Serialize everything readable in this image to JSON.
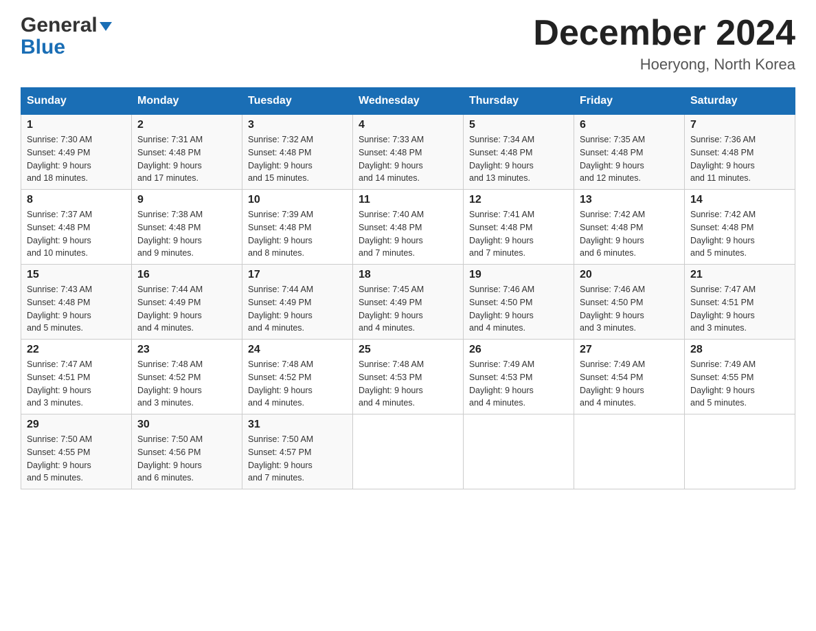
{
  "header": {
    "logo_general": "General",
    "logo_blue": "Blue",
    "month_title": "December 2024",
    "location": "Hoeryong, North Korea"
  },
  "weekdays": [
    "Sunday",
    "Monday",
    "Tuesday",
    "Wednesday",
    "Thursday",
    "Friday",
    "Saturday"
  ],
  "weeks": [
    [
      {
        "day": "1",
        "sunrise": "7:30 AM",
        "sunset": "4:49 PM",
        "daylight": "9 hours and 18 minutes."
      },
      {
        "day": "2",
        "sunrise": "7:31 AM",
        "sunset": "4:48 PM",
        "daylight": "9 hours and 17 minutes."
      },
      {
        "day": "3",
        "sunrise": "7:32 AM",
        "sunset": "4:48 PM",
        "daylight": "9 hours and 15 minutes."
      },
      {
        "day": "4",
        "sunrise": "7:33 AM",
        "sunset": "4:48 PM",
        "daylight": "9 hours and 14 minutes."
      },
      {
        "day": "5",
        "sunrise": "7:34 AM",
        "sunset": "4:48 PM",
        "daylight": "9 hours and 13 minutes."
      },
      {
        "day": "6",
        "sunrise": "7:35 AM",
        "sunset": "4:48 PM",
        "daylight": "9 hours and 12 minutes."
      },
      {
        "day": "7",
        "sunrise": "7:36 AM",
        "sunset": "4:48 PM",
        "daylight": "9 hours and 11 minutes."
      }
    ],
    [
      {
        "day": "8",
        "sunrise": "7:37 AM",
        "sunset": "4:48 PM",
        "daylight": "9 hours and 10 minutes."
      },
      {
        "day": "9",
        "sunrise": "7:38 AM",
        "sunset": "4:48 PM",
        "daylight": "9 hours and 9 minutes."
      },
      {
        "day": "10",
        "sunrise": "7:39 AM",
        "sunset": "4:48 PM",
        "daylight": "9 hours and 8 minutes."
      },
      {
        "day": "11",
        "sunrise": "7:40 AM",
        "sunset": "4:48 PM",
        "daylight": "9 hours and 7 minutes."
      },
      {
        "day": "12",
        "sunrise": "7:41 AM",
        "sunset": "4:48 PM",
        "daylight": "9 hours and 7 minutes."
      },
      {
        "day": "13",
        "sunrise": "7:42 AM",
        "sunset": "4:48 PM",
        "daylight": "9 hours and 6 minutes."
      },
      {
        "day": "14",
        "sunrise": "7:42 AM",
        "sunset": "4:48 PM",
        "daylight": "9 hours and 5 minutes."
      }
    ],
    [
      {
        "day": "15",
        "sunrise": "7:43 AM",
        "sunset": "4:48 PM",
        "daylight": "9 hours and 5 minutes."
      },
      {
        "day": "16",
        "sunrise": "7:44 AM",
        "sunset": "4:49 PM",
        "daylight": "9 hours and 4 minutes."
      },
      {
        "day": "17",
        "sunrise": "7:44 AM",
        "sunset": "4:49 PM",
        "daylight": "9 hours and 4 minutes."
      },
      {
        "day": "18",
        "sunrise": "7:45 AM",
        "sunset": "4:49 PM",
        "daylight": "9 hours and 4 minutes."
      },
      {
        "day": "19",
        "sunrise": "7:46 AM",
        "sunset": "4:50 PM",
        "daylight": "9 hours and 4 minutes."
      },
      {
        "day": "20",
        "sunrise": "7:46 AM",
        "sunset": "4:50 PM",
        "daylight": "9 hours and 3 minutes."
      },
      {
        "day": "21",
        "sunrise": "7:47 AM",
        "sunset": "4:51 PM",
        "daylight": "9 hours and 3 minutes."
      }
    ],
    [
      {
        "day": "22",
        "sunrise": "7:47 AM",
        "sunset": "4:51 PM",
        "daylight": "9 hours and 3 minutes."
      },
      {
        "day": "23",
        "sunrise": "7:48 AM",
        "sunset": "4:52 PM",
        "daylight": "9 hours and 3 minutes."
      },
      {
        "day": "24",
        "sunrise": "7:48 AM",
        "sunset": "4:52 PM",
        "daylight": "9 hours and 4 minutes."
      },
      {
        "day": "25",
        "sunrise": "7:48 AM",
        "sunset": "4:53 PM",
        "daylight": "9 hours and 4 minutes."
      },
      {
        "day": "26",
        "sunrise": "7:49 AM",
        "sunset": "4:53 PM",
        "daylight": "9 hours and 4 minutes."
      },
      {
        "day": "27",
        "sunrise": "7:49 AM",
        "sunset": "4:54 PM",
        "daylight": "9 hours and 4 minutes."
      },
      {
        "day": "28",
        "sunrise": "7:49 AM",
        "sunset": "4:55 PM",
        "daylight": "9 hours and 5 minutes."
      }
    ],
    [
      {
        "day": "29",
        "sunrise": "7:50 AM",
        "sunset": "4:55 PM",
        "daylight": "9 hours and 5 minutes."
      },
      {
        "day": "30",
        "sunrise": "7:50 AM",
        "sunset": "4:56 PM",
        "daylight": "9 hours and 6 minutes."
      },
      {
        "day": "31",
        "sunrise": "7:50 AM",
        "sunset": "4:57 PM",
        "daylight": "9 hours and 7 minutes."
      },
      null,
      null,
      null,
      null
    ]
  ]
}
